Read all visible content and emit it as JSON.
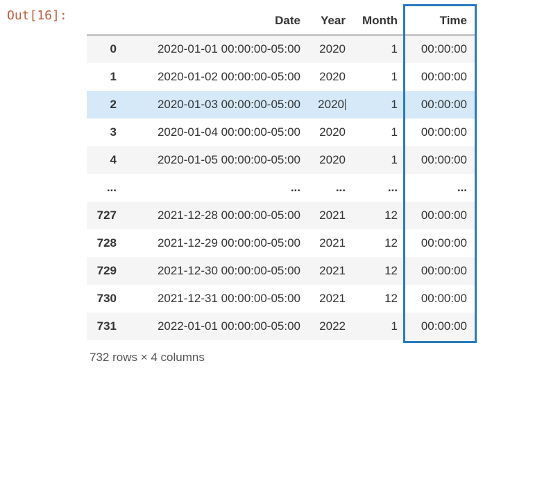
{
  "out_label": "Out[16]:",
  "headers": {
    "idx": "",
    "date": "Date",
    "year": "Year",
    "month": "Month",
    "time": "Time"
  },
  "rows": [
    {
      "idx": "0",
      "date": "2020-01-01 00:00:00-05:00",
      "year": "2020",
      "month": "1",
      "time": "00:00:00",
      "highlighted": false,
      "cursor": false
    },
    {
      "idx": "1",
      "date": "2020-01-02 00:00:00-05:00",
      "year": "2020",
      "month": "1",
      "time": "00:00:00",
      "highlighted": false,
      "cursor": false
    },
    {
      "idx": "2",
      "date": "2020-01-03 00:00:00-05:00",
      "year": "2020",
      "month": "1",
      "time": "00:00:00",
      "highlighted": true,
      "cursor": true
    },
    {
      "idx": "3",
      "date": "2020-01-04 00:00:00-05:00",
      "year": "2020",
      "month": "1",
      "time": "00:00:00",
      "highlighted": false,
      "cursor": false
    },
    {
      "idx": "4",
      "date": "2020-01-05 00:00:00-05:00",
      "year": "2020",
      "month": "1",
      "time": "00:00:00",
      "highlighted": false,
      "cursor": false
    },
    {
      "idx": "...",
      "date": "...",
      "year": "...",
      "month": "...",
      "time": "...",
      "highlighted": false,
      "ellipsis": true
    },
    {
      "idx": "727",
      "date": "2021-12-28 00:00:00-05:00",
      "year": "2021",
      "month": "12",
      "time": "00:00:00",
      "highlighted": false,
      "cursor": false
    },
    {
      "idx": "728",
      "date": "2021-12-29 00:00:00-05:00",
      "year": "2021",
      "month": "12",
      "time": "00:00:00",
      "highlighted": false,
      "cursor": false
    },
    {
      "idx": "729",
      "date": "2021-12-30 00:00:00-05:00",
      "year": "2021",
      "month": "12",
      "time": "00:00:00",
      "highlighted": false,
      "cursor": false
    },
    {
      "idx": "730",
      "date": "2021-12-31 00:00:00-05:00",
      "year": "2021",
      "month": "12",
      "time": "00:00:00",
      "highlighted": false,
      "cursor": false
    },
    {
      "idx": "731",
      "date": "2022-01-01 00:00:00-05:00",
      "year": "2022",
      "month": "1",
      "time": "00:00:00",
      "highlighted": false,
      "cursor": false
    }
  ],
  "footer": "732 rows × 4 columns"
}
